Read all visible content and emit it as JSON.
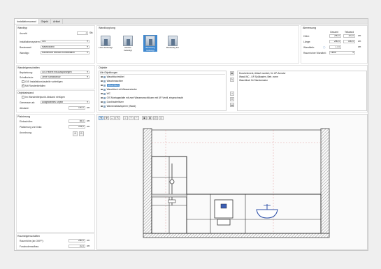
{
  "tabs": [
    "Installationswand",
    "Objekt",
    "Artikel"
  ],
  "wandtyp": {
    "title": "Wandtyp",
    "anzahl_label": "Anzahl:",
    "anzahl_value": "1",
    "anzahl_unit": "Stk",
    "installationssystem_label": "Installationssystem:",
    "installationssystem_value": "GIS",
    "basiswand_label": "Basiswand:",
    "basiswand_value": "Massivwand",
    "wandtyp_label": "Wandtyp:",
    "wandtyp_value": "Raumhoch/Teilhoch-Kombination"
  },
  "wandkopplung": {
    "title": "Wandkopplung",
    "options": [
      "Links beifestigt",
      "Rechts befestigt",
      "Beidseitig befestigt",
      "Beidseitig frei"
    ]
  },
  "abmessung": {
    "title": "Abmessung",
    "col1": "Gesamt",
    "col2": "Teilwand",
    "hoehe_label": "Höhe:",
    "hoehe_gesamt": "280,0",
    "hoehe_teil": "110,0",
    "laenge_label": "Länge:",
    "laenge_gesamt": "280,0",
    "laenge_teil": "160,0",
    "wandtiefe_label": "Wandtiefe:",
    "wandtiefe_value": "17,0",
    "unit": "cm",
    "raumhoher_label": "Raumhoher Wandteil:",
    "raumhoher_value": "Links"
  },
  "wandeigenschaften": {
    "title": "Wandeigenschaften",
    "beplankung_label": "Beplankung:",
    "beplankung_value": "GIS Paneel mit Aussparungen",
    "schallschutz_label": "Schallschutz:",
    "schallschutz_value": "Ohne Schallschutz",
    "cb1": "GIS Installationsbauteile vorfertigen",
    "cb2": "Mit Randentiefallen"
  },
  "objekte": {
    "title": "Objekte",
    "filter": "Alle Objektkrugen",
    "items": [
      "Waschtischmöbel",
      "Waschmaschine",
      "Waschtisch",
      "Waschtisch mit Wasserstrecke",
      "WC",
      "GIS Montageplatte mit zwei Wasseranschlüssen mit UP-Ventil, eingeschraubt",
      "Durchlauferhitzer",
      "Wannenablaufsperrer (Wand)"
    ]
  },
  "selected_list": [
    "Duschelement, Ablauf montiert, für UP-Armatur",
    "Wand-WC - UP-Spülkasten, Betr. vorne",
    "Waschtisch für Standarmatur"
  ],
  "objektabstand": {
    "title": "Objektabstand",
    "cb_label": "Im Wandmittelpunkt Abstand einfügen",
    "gemessen_label": "Gemessen ab:",
    "gemessen_value": "Ausgewähltes Objekt",
    "abstand_label": "Abstand:",
    "abstand_value": "100,0",
    "unit": "cm"
  },
  "platzierung": {
    "title": "Platzierung",
    "einbauhoehe_label": "Einbauhöhe:",
    "einbauhoehe_value": "85,0",
    "platzierung_label": "Platzierung von links:",
    "platzierung_value": "244,0",
    "unit": "cm",
    "anordnung_label": "Anordnung:"
  },
  "raumeigenschaften": {
    "title": "Raumeigenschaften",
    "raumhoehe_label": "Raumhöhe (ab OKFF):",
    "raumhoehe_value": "280,0",
    "fussboden_label": "Fussbodenaufbau:",
    "fussboden_value": "10,0",
    "unit": "cm"
  }
}
